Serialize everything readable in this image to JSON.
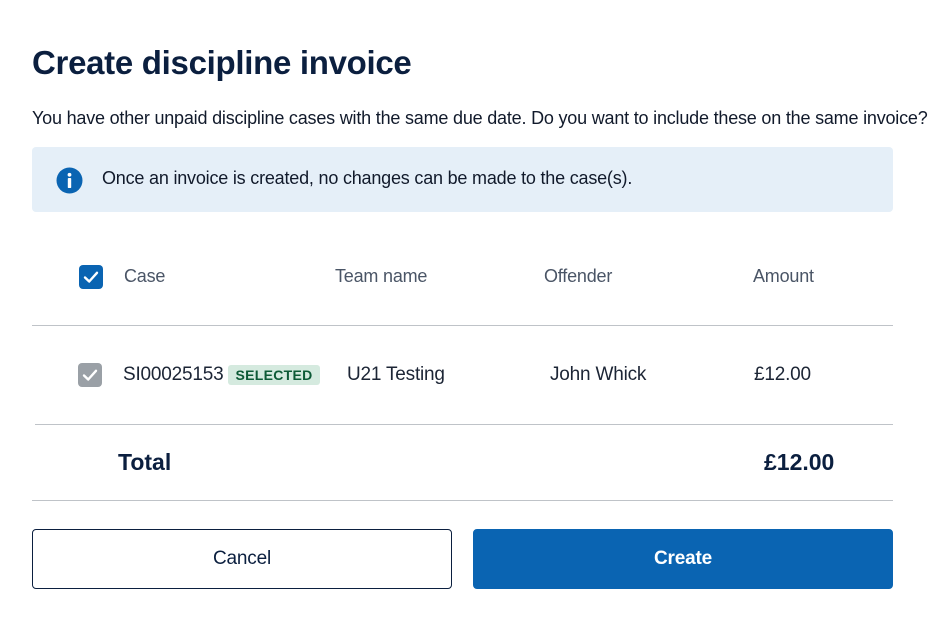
{
  "dialog": {
    "title": "Create discipline invoice",
    "subtitle": "You have other unpaid discipline cases with the same due date. Do you want to include these on the same invoice?"
  },
  "info": {
    "icon": "info-icon",
    "text": "Once an invoice is created, no changes can be made to the case(s)."
  },
  "table": {
    "select_all_checked": true,
    "headers": {
      "case": "Case",
      "team_name": "Team name",
      "offender": "Offender",
      "amount": "Amount"
    },
    "rows": [
      {
        "checked": true,
        "disabled": true,
        "case": "SI00025153",
        "badge": "SELECTED",
        "team_name": "U21 Testing",
        "offender": "John Whick",
        "amount": "£12.00"
      }
    ]
  },
  "total": {
    "label": "Total",
    "value": "£12.00"
  },
  "buttons": {
    "cancel": "Cancel",
    "create": "Create"
  },
  "colors": {
    "primary": "#0a64b2",
    "title": "#0b1f3f",
    "info_background": "#e5eff8",
    "badge_background": "#d5eadf",
    "badge_text": "#0d5a36",
    "disabled_checkbox": "#9aa0a6"
  }
}
